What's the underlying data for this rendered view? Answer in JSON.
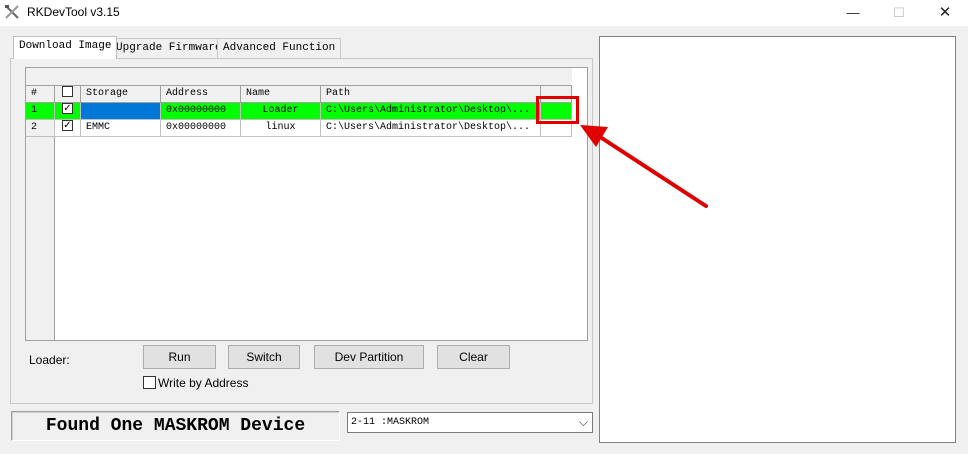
{
  "window": {
    "title": "RKDevTool v3.15",
    "icon": "tools-icon",
    "controls": {
      "minimize": "—",
      "maximize": "☐",
      "close": "✕"
    }
  },
  "tabs": [
    {
      "label": "Download Image",
      "active": true
    },
    {
      "label": "Upgrade Firmware",
      "active": false
    },
    {
      "label": "Advanced Function",
      "active": false
    }
  ],
  "grid": {
    "columns": [
      "#",
      "",
      "Storage",
      "Address",
      "Name",
      "Path",
      ""
    ],
    "rows": [
      {
        "num": "1",
        "checked": true,
        "storage": "",
        "address": "0x00000000",
        "name": "Loader",
        "path": "C:\\Users\\Administrator\\Desktop\\...",
        "highlight": "#00ff00"
      },
      {
        "num": "2",
        "checked": true,
        "storage": "EMMC",
        "address": "0x00000000",
        "name": "linux",
        "path": "C:\\Users\\Administrator\\Desktop\\...",
        "highlight": ""
      }
    ]
  },
  "loader_label": "Loader:",
  "buttons": {
    "run": "Run",
    "switch": "Switch",
    "dev_partition": "Dev Partition",
    "clear": "Clear"
  },
  "write_by_address": {
    "label": "Write by Address",
    "checked": false
  },
  "status": "Found One MASKROM Device",
  "device_select": {
    "value": "2-11 :MASKROM"
  },
  "colors": {
    "row_highlight": "#00ff00",
    "selection": "#0078d7",
    "annotation": "#e00000"
  }
}
